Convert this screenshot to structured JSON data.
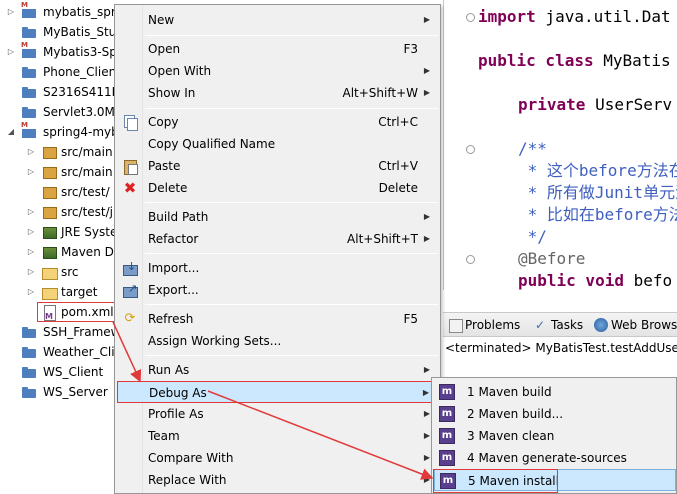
{
  "explorer": {
    "items": [
      {
        "twisty": "▷",
        "icon": "maven-project-icon",
        "label": "mybatis_spr"
      },
      {
        "twisty": "",
        "icon": "project-folder-icon",
        "label": "MyBatis_Stu"
      },
      {
        "twisty": "▷",
        "icon": "maven-project-icon",
        "label": "Mybatis3-Sp"
      },
      {
        "twisty": "",
        "icon": "project-folder-icon",
        "label": "Phone_Client"
      },
      {
        "twisty": "",
        "icon": "project-folder-icon",
        "label": "S2316S411H"
      },
      {
        "twisty": "",
        "icon": "project-folder-icon",
        "label": "Servlet3.0Ma"
      },
      {
        "twisty": "◢",
        "icon": "maven-project-icon",
        "label": "spring4-myb"
      },
      {
        "twisty": "▷",
        "icon": "package-folder-icon",
        "label": "src/main"
      },
      {
        "twisty": "▷",
        "icon": "package-folder-icon",
        "label": "src/main"
      },
      {
        "twisty": "",
        "icon": "package-folder-icon",
        "label": "src/test/"
      },
      {
        "twisty": "▷",
        "icon": "package-folder-icon",
        "label": "src/test/j"
      },
      {
        "twisty": "▷",
        "icon": "library-icon",
        "label": "JRE Syste"
      },
      {
        "twisty": "▷",
        "icon": "library-icon",
        "label": "Maven D"
      },
      {
        "twisty": "▷",
        "icon": "folder-icon",
        "label": "src"
      },
      {
        "twisty": "▷",
        "icon": "folder-icon",
        "label": "target"
      },
      {
        "twisty": "",
        "icon": "xml-file-icon",
        "label": "pom.xml"
      },
      {
        "twisty": "",
        "icon": "project-folder-icon",
        "label": "SSH_Framew"
      },
      {
        "twisty": "",
        "icon": "project-folder-icon",
        "label": "Weather_Clie"
      },
      {
        "twisty": "",
        "icon": "project-folder-icon",
        "label": "WS_Client"
      },
      {
        "twisty": "",
        "icon": "project-folder-icon",
        "label": "WS_Server"
      }
    ]
  },
  "editor": {
    "line1_kw": "import",
    "line1_rest": " java.util.Dat",
    "line2_kw": "public class",
    "line2_rest": " MyBatis",
    "line3_kw": "private",
    "line3_rest": " UserServ",
    "line4": "/**",
    "line5": " * 这个before方法在",
    "line6": " * 所有做Junit单元测",
    "line7": " * 比如在before方法",
    "line8": " */",
    "line9": "@Before",
    "line10_kw": "public void",
    "line10_rest": " befo"
  },
  "bottom_panel": {
    "tabs": [
      {
        "icon": "problems-icon",
        "label": "Problems"
      },
      {
        "icon": "tasks-icon",
        "label": "Tasks"
      },
      {
        "icon": "web-browser-icon",
        "label": "Web Brows"
      }
    ],
    "status_text": "<terminated> MyBatisTest.testAddUser"
  },
  "context_menu": {
    "new": {
      "label": "New"
    },
    "open": {
      "label": "Open",
      "shortcut": "F3"
    },
    "open_with": {
      "label": "Open With"
    },
    "show_in": {
      "label": "Show In",
      "shortcut": "Alt+Shift+W"
    },
    "copy": {
      "label": "Copy",
      "shortcut": "Ctrl+C"
    },
    "copy_qualified": {
      "label": "Copy Qualified Name"
    },
    "paste": {
      "label": "Paste",
      "shortcut": "Ctrl+V"
    },
    "delete": {
      "label": "Delete",
      "shortcut": "Delete"
    },
    "build_path": {
      "label": "Build Path"
    },
    "refactor": {
      "label": "Refactor",
      "shortcut": "Alt+Shift+T"
    },
    "import": {
      "label": "Import..."
    },
    "export": {
      "label": "Export..."
    },
    "refresh": {
      "label": "Refresh",
      "shortcut": "F5"
    },
    "assign_working_sets": {
      "label": "Assign Working Sets..."
    },
    "run_as": {
      "label": "Run As"
    },
    "debug_as": {
      "label": "Debug As"
    },
    "profile_as": {
      "label": "Profile As"
    },
    "team": {
      "label": "Team"
    },
    "compare_with": {
      "label": "Compare With"
    },
    "replace_with": {
      "label": "Replace With"
    }
  },
  "submenu": {
    "items": [
      {
        "label": "1 Maven build"
      },
      {
        "label": "2 Maven build..."
      },
      {
        "label": "3 Maven clean"
      },
      {
        "label": "4 Maven generate-sources"
      },
      {
        "label": "5 Maven install"
      }
    ],
    "icon_glyph": "m"
  },
  "colors": {
    "annotation": "#e0393a",
    "selection": "#cce8ff",
    "keyword": "#7f0055",
    "javadoc": "#3f5fbf"
  }
}
